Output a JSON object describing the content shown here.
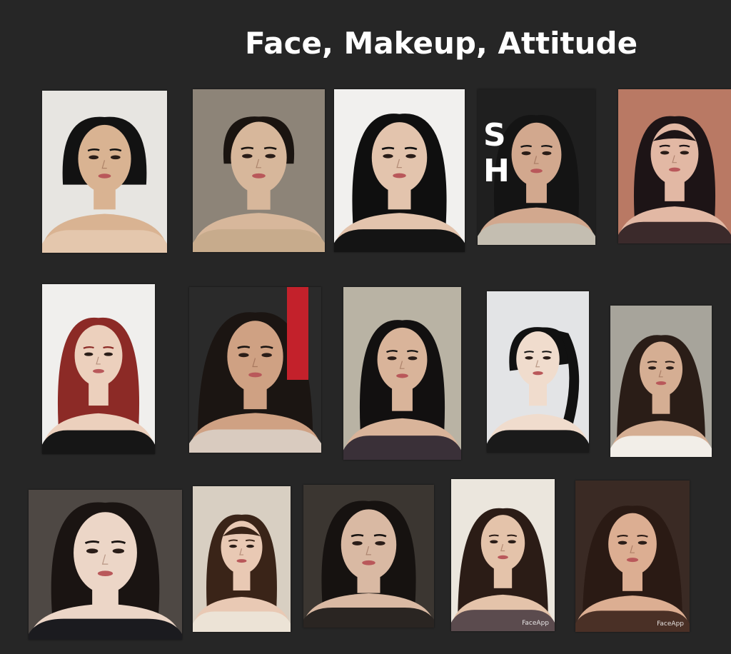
{
  "page": {
    "title": "Face, Makeup, Attitude",
    "background": "#262626"
  },
  "photos": [
    {
      "bg": "#e7e5e1",
      "hair": "#121212",
      "skin": "#d9b392",
      "cloth": "#e4c7ad",
      "hair_style": "bob"
    },
    {
      "bg": "#8d8478",
      "hair": "#1a1410",
      "skin": "#d7b79b",
      "cloth": "#c7ab8c",
      "hair_style": "tied"
    },
    {
      "bg": "#f1f0ee",
      "hair": "#0f0f0f",
      "skin": "#e3c4ad",
      "cloth": "#141414",
      "hair_style": "long"
    },
    {
      "bg": "#1f1f1f",
      "hair": "#141414",
      "skin": "#d2a88e",
      "cloth": "#c4beb1",
      "hair_style": "long",
      "sign_text": "S\nH"
    },
    {
      "bg": "#b97964",
      "hair": "#1d1416",
      "skin": "#e2b8a4",
      "cloth": "#3b2a2b",
      "hair_style": "bangs"
    },
    {
      "bg": "#f0efed",
      "hair": "#8c2a26",
      "skin": "#ecd0bd",
      "cloth": "#161616",
      "hair_style": "long"
    },
    {
      "bg": "#2a2a2a",
      "hair": "#1b1512",
      "skin": "#cfa183",
      "cloth": "#d9cbbf",
      "hair_style": "wavy",
      "red_band": true
    },
    {
      "bg": "#b9b3a4",
      "hair": "#121010",
      "skin": "#d9b49a",
      "cloth": "#3a3038",
      "hair_style": "long"
    },
    {
      "bg": "#e3e4e6",
      "hair": "#111111",
      "skin": "#f0dccd",
      "cloth": "#1a1a1a",
      "hair_style": "braid"
    },
    {
      "bg": "#a7a49b",
      "hair": "#2a1d17",
      "skin": "#d5ae93",
      "cloth": "#f2eee8",
      "hair_style": "wavy"
    },
    {
      "bg": "#4e4844",
      "hair": "#1a1412",
      "skin": "#ecd6c7",
      "cloth": "#1b1b1f",
      "hair_style": "long"
    },
    {
      "bg": "#d8cfc2",
      "hair": "#3a2418",
      "skin": "#e9c9b4",
      "cloth": "#ece3d6",
      "hair_style": "bangs"
    },
    {
      "bg": "#3b3631",
      "hair": "#161210",
      "skin": "#d9b9a3",
      "cloth": "#2a2522",
      "hair_style": "long"
    },
    {
      "bg": "#ebe6dd",
      "hair": "#2b1c16",
      "skin": "#e4c3aa",
      "cloth": "#5b4b4e",
      "hair_style": "wavy",
      "watermark": "FaceApp"
    },
    {
      "bg": "#3a2a24",
      "hair": "#2a1a14",
      "skin": "#dcae92",
      "cloth": "#4a3026",
      "hair_style": "wavy",
      "watermark": "FaceApp"
    }
  ]
}
